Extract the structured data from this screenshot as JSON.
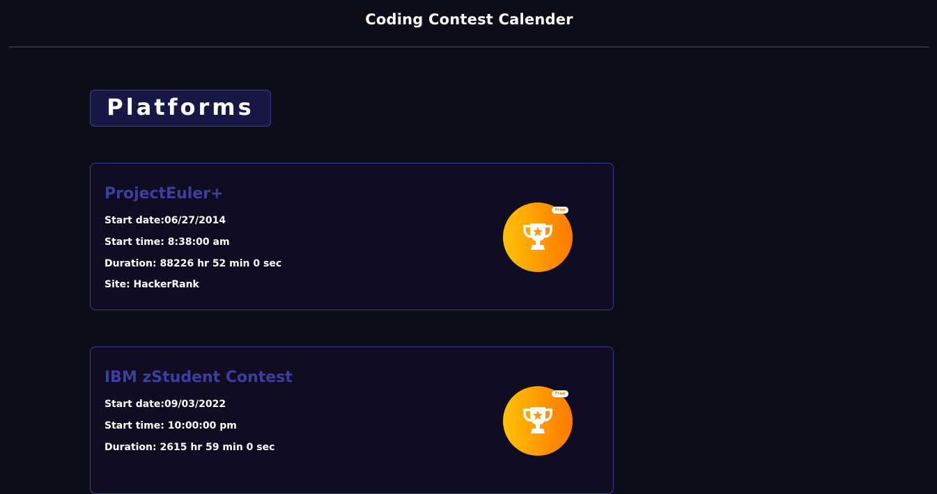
{
  "header": {
    "title": "Coding Contest Calender"
  },
  "section": {
    "title": "Platforms"
  },
  "contests": [
    {
      "name": "ProjectEuler+",
      "start_date": "Start date:06/27/2014",
      "start_time": "Start time: 8:38:00 am",
      "duration": "Duration: 88226 hr 52 min 0 sec",
      "site": "Site: HackerRank",
      "badge_icon": "trophy-icon",
      "badge_tag": "Free"
    },
    {
      "name": "IBM zStudent Contest",
      "start_date": "Start date:09/03/2022",
      "start_time": "Start time: 10:00:00 pm",
      "duration": "Duration: 2615 hr 59 min 0 sec",
      "site": "",
      "badge_icon": "trophy-icon",
      "badge_tag": "Free"
    }
  ],
  "colors": {
    "background": "#0b0d18",
    "accent": "#3d3fa0",
    "card_background": "#100c22",
    "badge_gradient_start": "#ffc107",
    "badge_gradient_end": "#ff7a00"
  }
}
